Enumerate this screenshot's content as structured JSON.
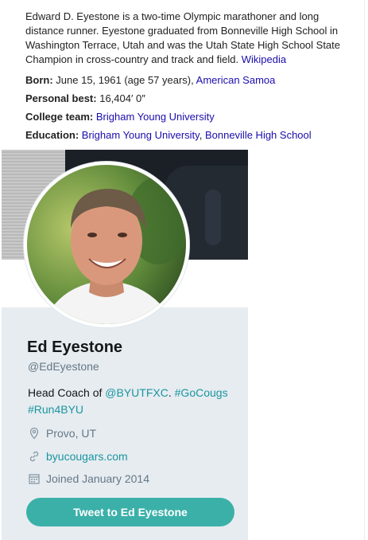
{
  "knowledge_panel": {
    "description": "Edward D. Eyestone is a two-time Olympic marathoner and long distance runner. Eyestone graduated from Bonneville High School in Washington Terrace, Utah and was the Utah State High School State Champion in cross-country and track and field.",
    "source_link": "Wikipedia",
    "born_label": "Born:",
    "born_value": "June 15, 1961 (age 57 years),",
    "born_place": "American Samoa",
    "pb_label": "Personal best:",
    "pb_value": "16,404′ 0″",
    "college_label": "College team:",
    "college_value": "Brigham Young University",
    "education_label": "Education:",
    "education_value_1": "Brigham Young University",
    "education_sep": ",",
    "education_value_2": "Bonneville High School"
  },
  "profile": {
    "name": "Ed Eyestone",
    "handle": "@EdEyestone",
    "bio_prefix": "Head Coach of",
    "bio_mention": "@BYUTFXC",
    "bio_dot": ".",
    "bio_tag1": "#GoCougs",
    "bio_tag2": "#Run4BYU",
    "location": "Provo, UT",
    "website": "byucougars.com",
    "joined": "Joined January 2014",
    "tweet_button": "Tweet to Ed Eyestone"
  },
  "icons": {
    "location": "location-pin-icon",
    "link": "link-icon",
    "calendar": "calendar-icon"
  },
  "colors": {
    "link_blue": "#1a0dab",
    "accent_teal": "#1b95a0",
    "button_teal": "#3bb0a9",
    "card_bg": "#e6ecf0",
    "muted": "#657786"
  }
}
